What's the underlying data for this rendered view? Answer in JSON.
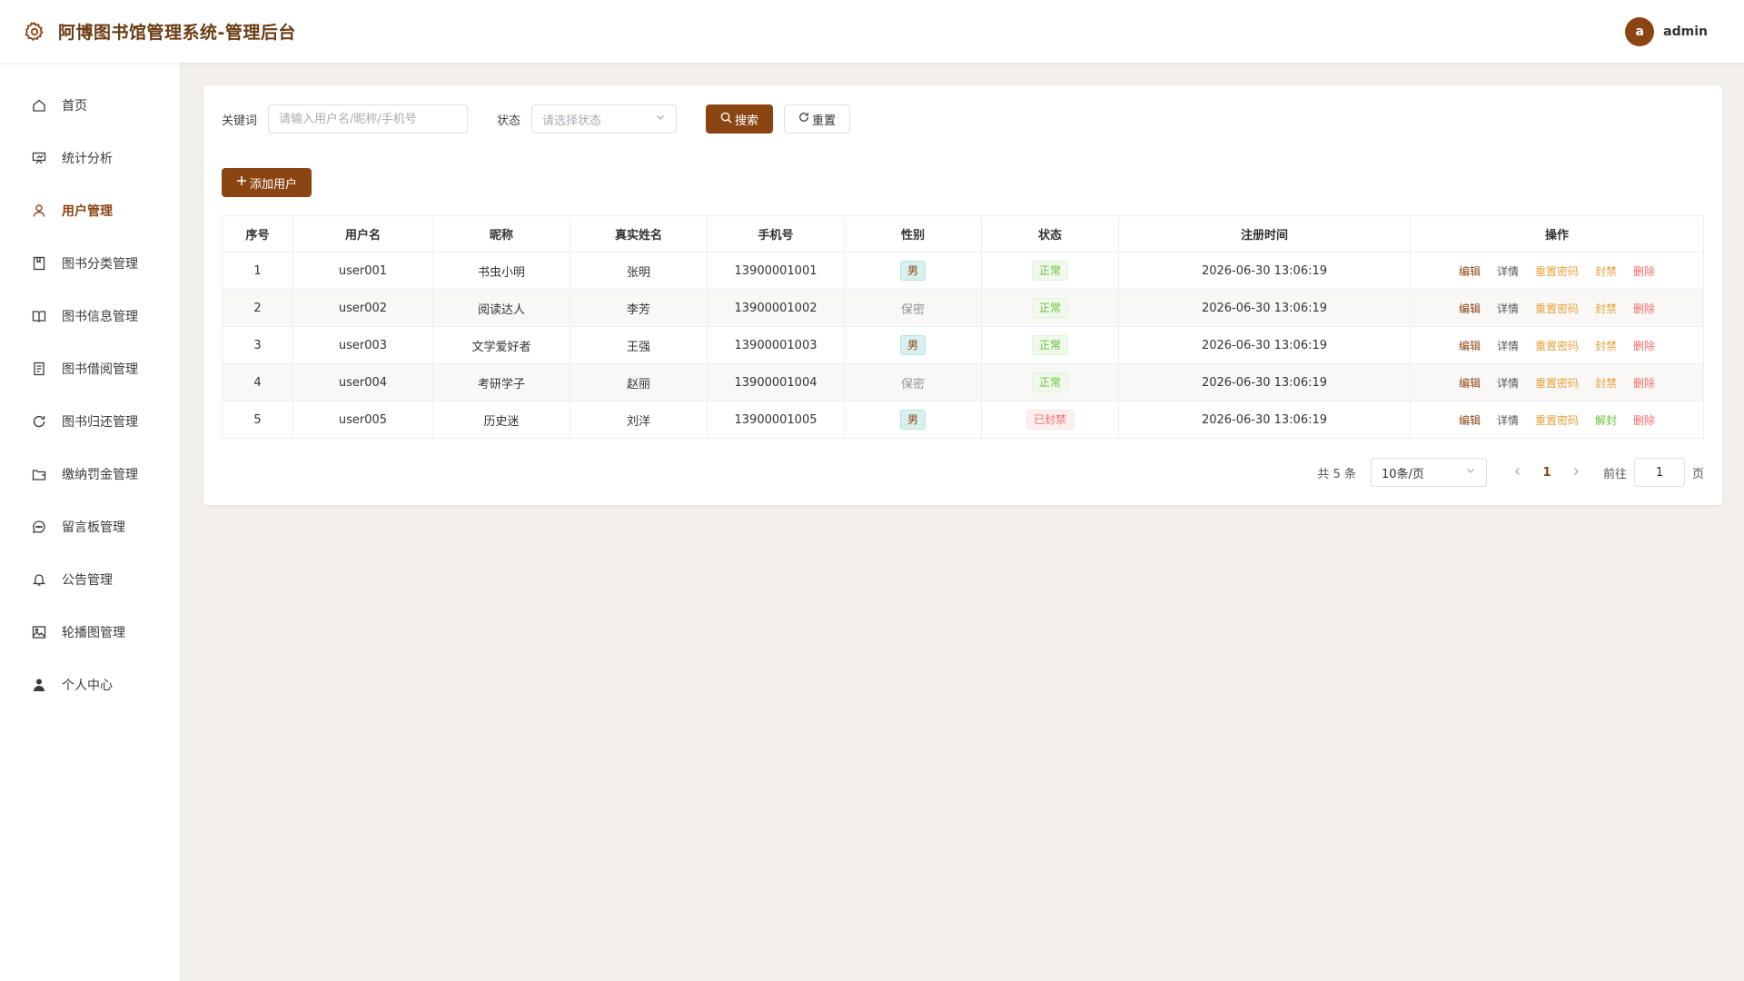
{
  "header": {
    "title": "阿博图书馆管理系统-管理后台",
    "user_initial": "a",
    "username": "admin"
  },
  "sidebar": {
    "items": [
      {
        "label": "首页",
        "icon": "home-icon"
      },
      {
        "label": "统计分析",
        "icon": "presentation-chart-icon"
      },
      {
        "label": "用户管理",
        "icon": "user-icon",
        "active": true
      },
      {
        "label": "图书分类管理",
        "icon": "bookmark-book-icon"
      },
      {
        "label": "图书信息管理",
        "icon": "open-book-icon"
      },
      {
        "label": "图书借阅管理",
        "icon": "document-icon"
      },
      {
        "label": "图书归还管理",
        "icon": "refresh-icon"
      },
      {
        "label": "缴纳罚金管理",
        "icon": "wallet-icon"
      },
      {
        "label": "留言板管理",
        "icon": "chat-bubble-icon"
      },
      {
        "label": "公告管理",
        "icon": "bell-icon"
      },
      {
        "label": "轮播图管理",
        "icon": "picture-icon"
      },
      {
        "label": "个人中心",
        "icon": "user-filled-icon"
      }
    ]
  },
  "search": {
    "keyword_label": "关键词",
    "keyword_placeholder": "请输入用户名/昵称/手机号",
    "status_label": "状态",
    "status_placeholder": "请选择状态",
    "search_button": "搜索",
    "reset_button": "重置"
  },
  "add_button": "添加用户",
  "table": {
    "columns": [
      "序号",
      "用户名",
      "昵称",
      "真实姓名",
      "手机号",
      "性别",
      "状态",
      "注册时间",
      "操作"
    ],
    "rows": [
      {
        "index": "1",
        "username": "user001",
        "nickname": "书虫小明",
        "realname": "张明",
        "phone": "13900001001",
        "gender": "男",
        "status": "正常",
        "registered": "2026-06-30 13:06:19",
        "ban_action": "封禁"
      },
      {
        "index": "2",
        "username": "user002",
        "nickname": "阅读达人",
        "realname": "李芳",
        "phone": "13900001002",
        "gender": "保密",
        "status": "正常",
        "registered": "2026-06-30 13:06:19",
        "ban_action": "封禁"
      },
      {
        "index": "3",
        "username": "user003",
        "nickname": "文学爱好者",
        "realname": "王强",
        "phone": "13900001003",
        "gender": "男",
        "status": "正常",
        "registered": "2026-06-30 13:06:19",
        "ban_action": "封禁"
      },
      {
        "index": "4",
        "username": "user004",
        "nickname": "考研学子",
        "realname": "赵丽",
        "phone": "13900001004",
        "gender": "保密",
        "status": "正常",
        "registered": "2026-06-30 13:06:19",
        "ban_action": "封禁"
      },
      {
        "index": "5",
        "username": "user005",
        "nickname": "历史迷",
        "realname": "刘洋",
        "phone": "13900001005",
        "gender": "男",
        "status": "已封禁",
        "registered": "2026-06-30 13:06:19",
        "ban_action": "解封"
      }
    ],
    "ops": {
      "edit": "编辑",
      "detail": "详情",
      "reset_pwd": "重置密码",
      "delete": "删除"
    }
  },
  "pagination": {
    "total_text": "共 5 条",
    "page_size": "10条/页",
    "current_page": "1",
    "goto_label": "前往",
    "goto_value": "1",
    "page_suffix": "页"
  },
  "colors": {
    "brand": "#8b4513",
    "title": "#6b3c13",
    "background": "#f3f0ec",
    "success": "#67c23a",
    "warning": "#e6a23c",
    "danger": "#f56c6c"
  }
}
